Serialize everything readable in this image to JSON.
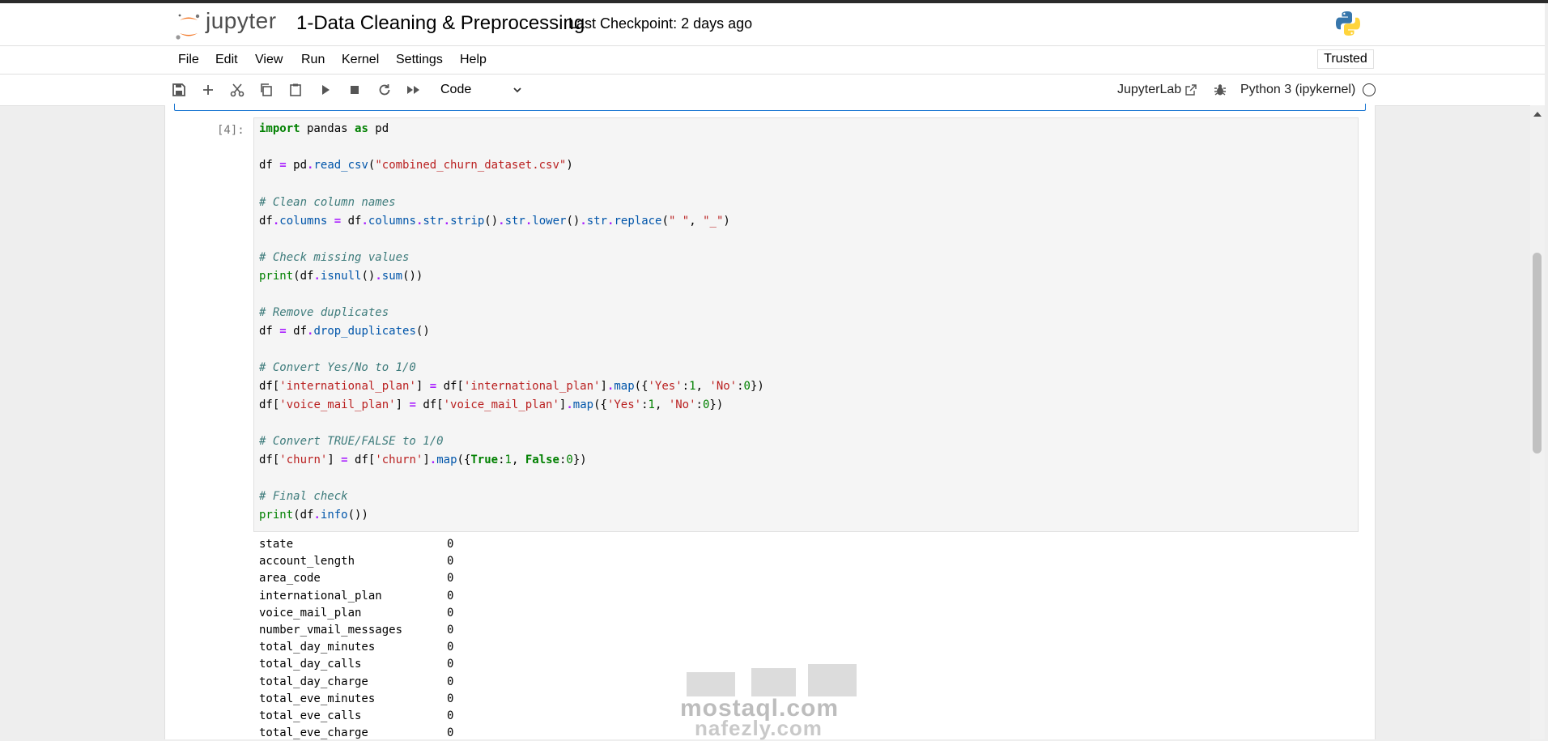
{
  "header": {
    "logo_text": "jupyter",
    "notebook_title": "1-Data Cleaning & Preprocessing",
    "checkpoint": "Last Checkpoint: 2 days ago"
  },
  "menu": {
    "items": [
      "File",
      "Edit",
      "View",
      "Run",
      "Kernel",
      "Settings",
      "Help"
    ],
    "trusted": "Trusted"
  },
  "toolbar": {
    "buttons": [
      "save-icon",
      "add-icon",
      "cut-icon",
      "copy-icon",
      "paste-icon",
      "run-icon",
      "stop-icon",
      "restart-icon",
      "fast-forward-icon"
    ],
    "cell_type": "Code",
    "jupyterlab_label": "JupyterLab",
    "kernel_name": "Python 3 (ipykernel)"
  },
  "cell": {
    "prompt": "[4]:"
  },
  "output": {
    "rows": [
      [
        "state",
        "0"
      ],
      [
        "account_length",
        "0"
      ],
      [
        "area_code",
        "0"
      ],
      [
        "international_plan",
        "0"
      ],
      [
        "voice_mail_plan",
        "0"
      ],
      [
        "number_vmail_messages",
        "0"
      ],
      [
        "total_day_minutes",
        "0"
      ],
      [
        "total_day_calls",
        "0"
      ],
      [
        "total_day_charge",
        "0"
      ],
      [
        "total_eve_minutes",
        "0"
      ],
      [
        "total_eve_calls",
        "0"
      ],
      [
        "total_eve_charge",
        "0"
      ]
    ]
  },
  "watermark": {
    "line1": "mostaql.com",
    "line2": "nafezly.com"
  },
  "colors": {
    "accent": "#1976d2",
    "keyword": "#008000",
    "string": "#ba2121",
    "comment": "#3d7b7b"
  }
}
